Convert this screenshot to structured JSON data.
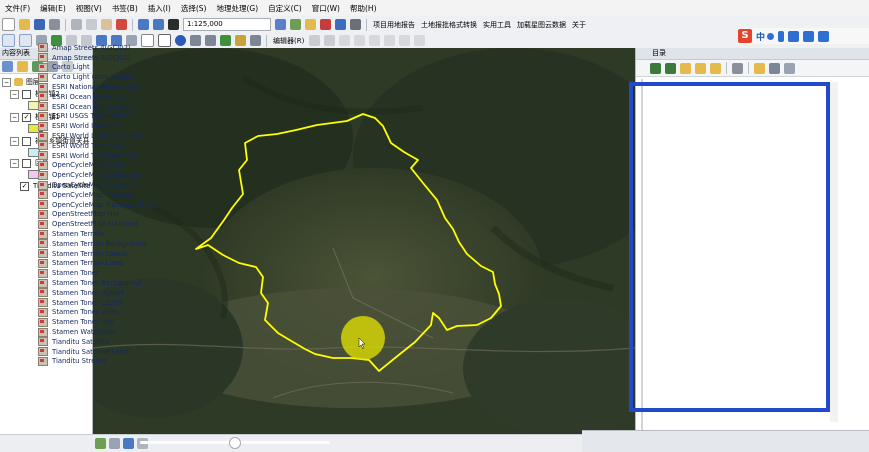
{
  "menu": [
    "文件(F)",
    "编辑(E)",
    "视图(V)",
    "书签(B)",
    "插入(I)",
    "选择(S)",
    "地理处理(G)",
    "自定义(C)",
    "窗口(W)",
    "帮助(H)"
  ],
  "toolbar": {
    "scale": "1:125,000",
    "plugins": [
      "项目用地报告",
      "土地报批格式转换",
      "实用工具",
      "加载星图云数据",
      "关于"
    ],
    "editor": "编辑器(R)"
  },
  "ime": {
    "logo": "S",
    "lang": "中"
  },
  "toc": {
    "title": "内容列表",
    "root": "图层",
    "layers": [
      {
        "name": "横头镇2",
        "checked": false,
        "swatch": "#f2f3b5"
      },
      {
        "name": "横头镇1",
        "checked": true,
        "swatch": "#e8e838"
      },
      {
        "name": "福建乡镇街道关县",
        "checked": false,
        "swatch": "#c8eef5"
      },
      {
        "name": "区县",
        "checked": false,
        "swatch": "#f2c7f2"
      },
      {
        "name": "Tianditu Satellite",
        "checked": true,
        "swatch": ""
      }
    ]
  },
  "catalog": {
    "title": "目录",
    "items": [
      "Amap Streets 4(GCJ02)",
      "Amap Streets 5(GCJ02)",
      "Carto Light",
      "Carto Light (only labels)",
      "ESRI National Geographic",
      "ESRI Ocean Basemap",
      "ESRI Ocean Bathymetric",
      "ESRI USGS Topographic",
      "ESRI World Imagery",
      "ESRI World Light Gray Base",
      "ESRI World Topo Map",
      "ESRI World Transporation",
      "OpenCycleMap Cycle",
      "OpenCycleMap Landscape",
      "OpenCycleMap Outdoors",
      "OpenCycleMap Transport",
      "OpenCycleMap Transport Dark",
      "OpenStreetMap Hot",
      "OpenStreetMap Standard",
      "Stamen Terrain",
      "Stamen Terrain Background",
      "Stamen Terrain Labels",
      "Stamen Terrain Lines",
      "Stamen Toner",
      "Stamen Toner Background",
      "Stamen Toner Hybrid",
      "Stamen Toner Labels",
      "Stamen Toner Lines",
      "Stamen Toner Lite",
      "Stamen Watercolor",
      "Tianditu Satellite",
      "Tianditu Satellite Label",
      "Tianditu Streets"
    ]
  },
  "colors": {
    "highlight": "#2149c9",
    "boundary": "#ffff00"
  }
}
